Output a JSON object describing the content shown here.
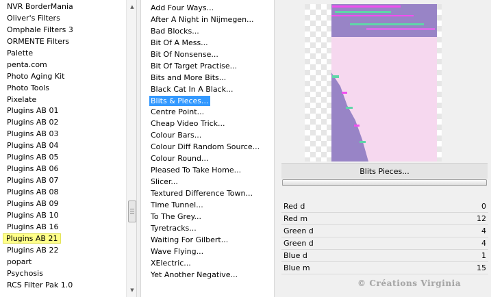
{
  "categories": {
    "items": [
      "NVR BorderMania",
      "Oliver's Filters",
      "Omphale Filters 3",
      "ORMENTE Filters",
      "Palette",
      "penta.com",
      "Photo Aging Kit",
      "Photo Tools",
      "Pixelate",
      "Plugins AB 01",
      "Plugins AB 02",
      "Plugins AB 03",
      "Plugins AB 04",
      "Plugins AB 05",
      "Plugins AB 06",
      "Plugins AB 07",
      "Plugins AB 08",
      "Plugins AB 09",
      "Plugins AB 10",
      "Plugins AB 16",
      "Plugins AB 21",
      "Plugins AB 22",
      "popart",
      "Psychosis",
      "RCS Filter Pak 1.0"
    ],
    "selected": "Plugins AB 21"
  },
  "filters": {
    "items": [
      "Add Four Ways...",
      "After A Night in Nijmegen...",
      "Bad Blocks...",
      "Bit Of A Mess...",
      "Bit Of Nonsense...",
      "Bit Of Target Practise...",
      "Bits and More Bits...",
      "Black Cat In A Black...",
      "Blits & Pieces...",
      "Centre Point...",
      "Cheap Video Trick...",
      "Colour Bars...",
      "Colour Diff Random Source...",
      "Colour Round...",
      "Pleased To Take Home...",
      "Slicer...",
      "Textured Difference Town...",
      "Time Tunnel...",
      "To The Grey...",
      "Tyretracks...",
      "Waiting For Gilbert...",
      "Wave Flying...",
      "XElectric...",
      "Yet Another Negative..."
    ],
    "selected": "Blits & Pieces..."
  },
  "preview": {
    "title": "Blits  Pieces...",
    "colors": {
      "lavender": "#9884c6",
      "pink": "#f6d8ef",
      "magenta": "#f24ef0",
      "mint": "#5fd6a8",
      "checker": "#e6e6e6"
    }
  },
  "params": [
    {
      "label": "Red d",
      "value": "0"
    },
    {
      "label": "Red m",
      "value": "12"
    },
    {
      "label": "Green d",
      "value": "4"
    },
    {
      "label": "Green d",
      "value": "4"
    },
    {
      "label": "Blue d",
      "value": "1"
    },
    {
      "label": "Blue m",
      "value": "15"
    }
  ],
  "watermark": "© Créations Virginia",
  "icons": {
    "scroll_up": "scroll-up-arrow-icon",
    "scroll_down": "scroll-down-arrow-icon"
  }
}
